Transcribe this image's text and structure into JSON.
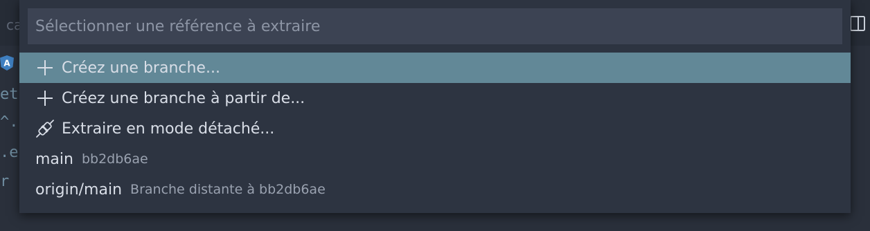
{
  "background": {
    "tab_hint": "ca",
    "code_fragments": [
      "et",
      "^.",
      ".e",
      "r"
    ]
  },
  "quick_pick": {
    "placeholder": "Sélectionner une référence à extraire",
    "value": "",
    "items": [
      {
        "icon": "plus-icon",
        "label": "Créez une branche...",
        "description": "",
        "selected": true
      },
      {
        "icon": "plus-icon",
        "label": "Créez une branche à partir de...",
        "description": "",
        "selected": false
      },
      {
        "icon": "debug-disconnect-icon",
        "label": "Extraire en mode détaché...",
        "description": "",
        "selected": false
      },
      {
        "icon": "",
        "label": "main",
        "description": "bb2db6ae",
        "selected": false
      },
      {
        "icon": "",
        "label": "origin/main",
        "description": "Branche distante à bb2db6ae",
        "selected": false
      }
    ]
  },
  "colors": {
    "selection": "#628897",
    "widget_bg": "#2d3441",
    "input_bg": "#3c4353"
  }
}
